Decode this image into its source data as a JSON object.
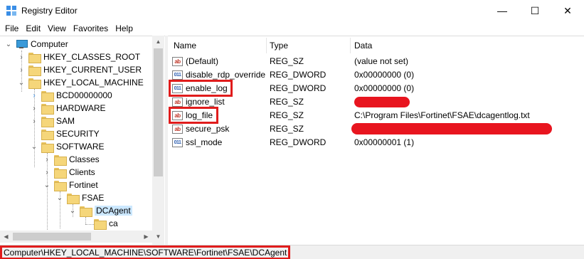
{
  "window": {
    "title": "Registry Editor",
    "min_glyph": "—",
    "max_glyph": "☐",
    "close_glyph": "✕"
  },
  "menu": [
    "File",
    "Edit",
    "View",
    "Favorites",
    "Help"
  ],
  "tree": {
    "root": "Computer",
    "items": [
      {
        "label": "HKEY_CLASSES_ROOT",
        "expander": "›"
      },
      {
        "label": "HKEY_CURRENT_USER",
        "expander": "›"
      },
      {
        "label": "HKEY_LOCAL_MACHINE",
        "expander": "⌄"
      },
      {
        "label": "BCD00000000",
        "expander": "›"
      },
      {
        "label": "HARDWARE",
        "expander": "›"
      },
      {
        "label": "SAM",
        "expander": "›"
      },
      {
        "label": "SECURITY",
        "expander": ""
      },
      {
        "label": "SOFTWARE",
        "expander": "⌄"
      },
      {
        "label": "Classes",
        "expander": "›"
      },
      {
        "label": "Clients",
        "expander": "›"
      },
      {
        "label": "Fortinet",
        "expander": "⌄"
      },
      {
        "label": "FSAE",
        "expander": "⌄"
      },
      {
        "label": "DCAgent",
        "expander": "⌄"
      },
      {
        "label": "ca",
        "expander": ""
      }
    ]
  },
  "list": {
    "columns": [
      "Name",
      "Type",
      "Data"
    ],
    "rows": [
      {
        "name": "(Default)",
        "type": "REG_SZ",
        "data": "(value not set)",
        "icon": "ab"
      },
      {
        "name": "disable_rdp_override",
        "type": "REG_DWORD",
        "data": "0x00000000 (0)",
        "icon": "dw"
      },
      {
        "name": "enable_log",
        "type": "REG_DWORD",
        "data": "0x00000000 (0)",
        "icon": "dw"
      },
      {
        "name": "ignore_list",
        "type": "REG_SZ",
        "data": "",
        "icon": "ab"
      },
      {
        "name": "log_file",
        "type": "REG_SZ",
        "data": "C:\\Program Files\\Fortinet\\FSAE\\dcagentlog.txt",
        "icon": "ab"
      },
      {
        "name": "secure_psk",
        "type": "REG_SZ",
        "data": "",
        "icon": "ab"
      },
      {
        "name": "ssl_mode",
        "type": "REG_DWORD",
        "data": "0x00000001 (1)",
        "icon": "dw"
      }
    ],
    "icon_labels": {
      "ab": "ab",
      "dw": "011"
    }
  },
  "status": {
    "path": "Computer\\HKEY_LOCAL_MACHINE\\SOFTWARE\\Fortinet\\FSAE\\DCAgent"
  },
  "colors": {
    "highlight_box": "#e01c1c",
    "selection": "#cce8ff",
    "redaction": "#e8151f"
  }
}
